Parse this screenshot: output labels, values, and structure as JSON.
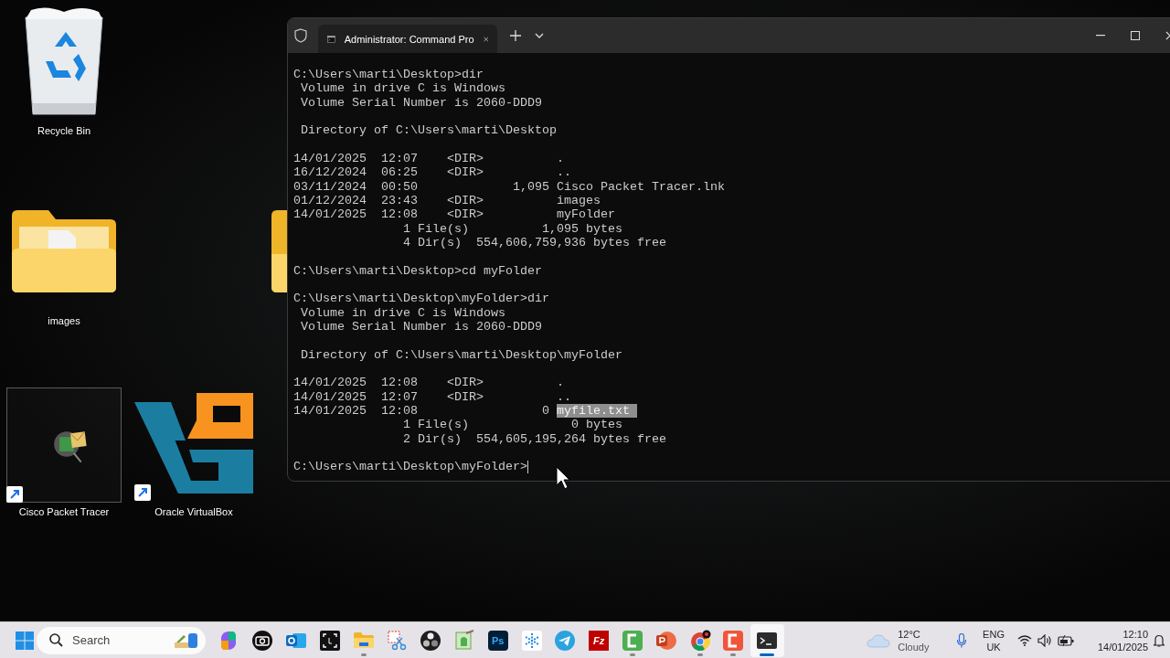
{
  "desktop_icons": [
    {
      "label": "Recycle Bin",
      "kind": "recycle-bin",
      "selected": false,
      "shortcut": false
    },
    {
      "label": "images",
      "kind": "folder",
      "selected": false,
      "shortcut": false
    },
    {
      "label": "Cisco Packet Tracer",
      "kind": "packet-tracer",
      "selected": true,
      "shortcut": true
    },
    {
      "label": "Oracle VirtualBox",
      "kind": "virtualbox",
      "selected": false,
      "shortcut": true
    }
  ],
  "terminal": {
    "tab_title": "Administrator: Command Pro",
    "output": [
      [
        {
          "text": "C:\\Users\\marti\\Desktop>dir"
        },
        {
          "text": " Volume in drive C is Windows"
        },
        {
          "text": " Volume Serial Number is 2060-DDD9"
        }
      ],
      [
        {
          "text": " Directory of C:\\Users\\marti\\Desktop"
        }
      ],
      [
        {
          "text": "14/01/2025  12:07    <DIR>          ."
        },
        {
          "text": "16/12/2024  06:25    <DIR>          .."
        },
        {
          "text": "03/11/2024  00:50             1,095 Cisco Packet Tracer.lnk"
        },
        {
          "text": "01/12/2024  23:43    <DIR>          images"
        },
        {
          "text": "14/01/2025  12:08    <DIR>          myFolder"
        },
        {
          "text": "               1 File(s)          1,095 bytes"
        },
        {
          "text": "               4 Dir(s)  554,606,759,936 bytes free"
        }
      ],
      [
        {
          "text": "C:\\Users\\marti\\Desktop>cd myFolder"
        }
      ],
      [
        {
          "text": "C:\\Users\\marti\\Desktop\\myFolder>dir"
        },
        {
          "text": " Volume in drive C is Windows"
        },
        {
          "text": " Volume Serial Number is 2060-DDD9"
        }
      ],
      [
        {
          "text": " Directory of C:\\Users\\marti\\Desktop\\myFolder"
        }
      ],
      [
        {
          "text": "14/01/2025  12:08    <DIR>          ."
        },
        {
          "text": "14/01/2025  12:07    <DIR>          .."
        },
        {
          "text": "14/01/2025  12:08                 0 ",
          "selection": "myfile.txt "
        },
        {
          "text": "               1 File(s)              0 bytes"
        },
        {
          "text": "               2 Dir(s)  554,605,195,264 bytes free"
        }
      ],
      [
        {
          "text": "C:\\Users\\marti\\Desktop\\myFolder>",
          "cursor": true
        }
      ]
    ]
  },
  "taskbar": {
    "search_placeholder": "Search",
    "apps": [
      {
        "kind": "copilot",
        "running": false,
        "selected": false
      },
      {
        "kind": "camera",
        "running": false,
        "selected": false
      },
      {
        "kind": "outlook",
        "running": false,
        "selected": false
      },
      {
        "kind": "capture",
        "running": false,
        "selected": false
      },
      {
        "kind": "explorer",
        "running": true,
        "selected": false
      },
      {
        "kind": "snipping",
        "running": false,
        "selected": false
      },
      {
        "kind": "obs",
        "running": false,
        "selected": false
      },
      {
        "kind": "editor",
        "running": false,
        "selected": false
      },
      {
        "kind": "photoshop",
        "glyph": "Ps",
        "running": false,
        "selected": false
      },
      {
        "kind": "snowflake",
        "running": false,
        "selected": false
      },
      {
        "kind": "telegram",
        "running": false,
        "selected": false
      },
      {
        "kind": "filezilla",
        "glyph": "Fz",
        "running": false,
        "selected": false
      },
      {
        "kind": "camtasia-green",
        "running": true,
        "selected": false
      },
      {
        "kind": "powerpoint",
        "running": false,
        "selected": false
      },
      {
        "kind": "chrome",
        "running": true,
        "selected": false
      },
      {
        "kind": "camtasia-red",
        "running": true,
        "selected": false
      },
      {
        "kind": "terminal",
        "running": true,
        "selected": true
      }
    ],
    "weather": {
      "temperature": "12°C",
      "condition": "Cloudy"
    },
    "language": {
      "code": "ENG",
      "region": "UK"
    },
    "clock": {
      "time": "12:10",
      "date": "14/01/2025"
    }
  }
}
